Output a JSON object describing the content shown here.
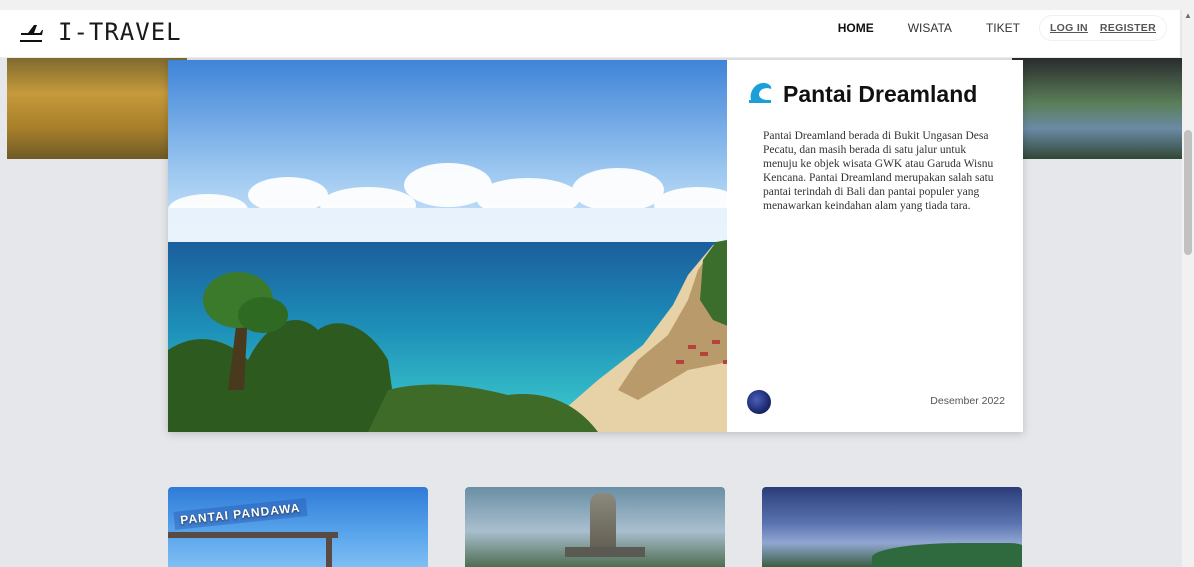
{
  "brand": {
    "name": "I-TRAVEL",
    "icon": "airplane-departure-icon"
  },
  "nav": {
    "items": [
      {
        "label": "HOME",
        "active": true
      },
      {
        "label": "WISATA",
        "active": false
      },
      {
        "label": "TIKET",
        "active": false
      }
    ],
    "login_label": "LOG IN",
    "register_label": "REGISTER"
  },
  "feature": {
    "title": "Pantai Dreamland",
    "title_icon": "wave-icon",
    "description": "Pantai Dreamland berada di Bukit Ungasan Desa Pecatu, dan masih berada di satu jalur untuk menuju ke objek wisata GWK atau Garuda Wisnu Kencana. Pantai Dreamland merupakan salah satu pantai terindah di Bali dan pantai populer yang menawarkan keindahan alam yang tiada tara.",
    "date": "Desember 2022"
  },
  "thumbs": [
    {
      "caption": "PANTAI PANDAWA"
    },
    {
      "caption": ""
    },
    {
      "caption": ""
    }
  ],
  "colors": {
    "accent": "#1a9fd9",
    "page_bg": "#e6e7ea"
  }
}
